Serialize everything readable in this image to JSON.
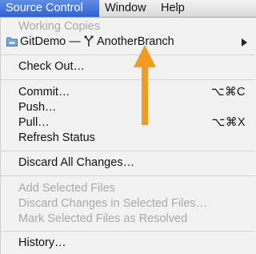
{
  "menubar": {
    "items": [
      {
        "label": "Source Control",
        "active": true
      },
      {
        "label": "Window",
        "active": false
      },
      {
        "label": "Help",
        "active": false
      }
    ]
  },
  "menu": {
    "working_copies_header": "Working Copies",
    "repo": {
      "name": "GitDemo",
      "separator": "—",
      "branch": "AnotherBranch"
    },
    "check_out": "Check Out…",
    "commit": {
      "label": "Commit…",
      "shortcut": "⌥⌘C"
    },
    "push": "Push…",
    "pull": {
      "label": "Pull…",
      "shortcut": "⌥⌘X"
    },
    "refresh_status": "Refresh Status",
    "discard_all": "Discard All Changes…",
    "add_selected": "Add Selected Files",
    "discard_selected": "Discard Changes in Selected Files…",
    "mark_resolved": "Mark Selected Files as Resolved",
    "history": "History…"
  },
  "colors": {
    "menubar_highlight": "#2f62d3",
    "callout_arrow": "#f39a1f",
    "disabled_text": "#a9a9a9"
  },
  "icons": [
    "folder-icon",
    "branch-icon",
    "submenu-arrow-icon",
    "callout-arrow-icon"
  ]
}
